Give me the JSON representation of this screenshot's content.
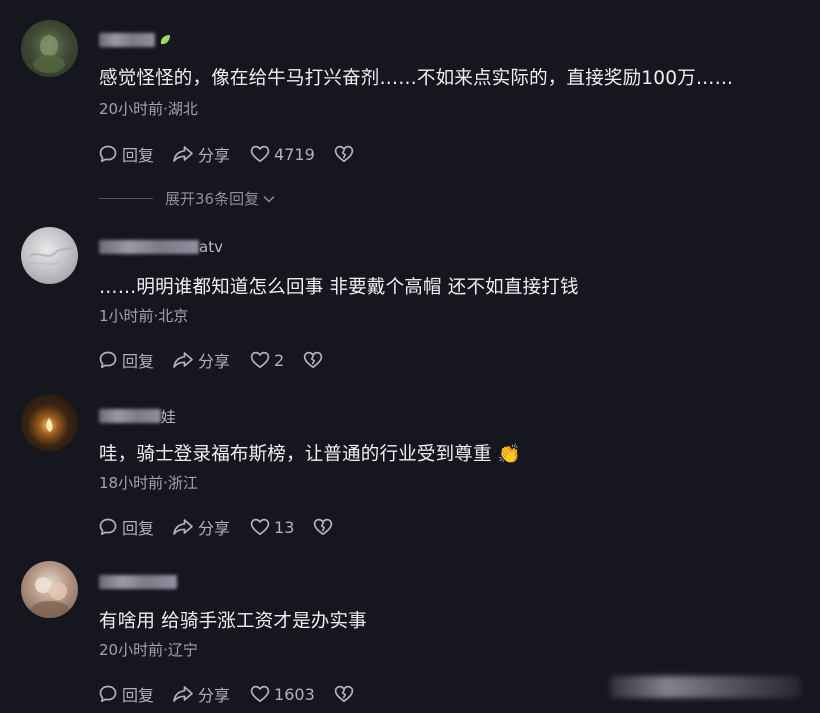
{
  "comments": [
    {
      "username_suffix": "",
      "text": "感觉怪怪的，像在给牛马打兴奋剂……不如来点实际的，直接奖励100万……",
      "meta": "20小时前·湖北",
      "reply_label": "回复",
      "share_label": "分享",
      "likes": "4719"
    },
    {
      "username_suffix": "atv",
      "text": "……明明谁都知道怎么回事 非要戴个高帽 还不如直接打钱",
      "meta": "1小时前·北京",
      "reply_label": "回复",
      "share_label": "分享",
      "likes": "2"
    },
    {
      "username_suffix": "娃",
      "text": "哇，骑士登录福布斯榜，让普通的行业受到尊重 👏",
      "meta": "18小时前·浙江",
      "reply_label": "回复",
      "share_label": "分享",
      "likes": "13"
    },
    {
      "username_suffix": "",
      "text": "有啥用 给骑手涨工资才是办实事",
      "meta": "20小时前·辽宁",
      "reply_label": "回复",
      "share_label": "分享",
      "likes": "1603"
    }
  ],
  "expand_replies": "展开36条回复",
  "colors": {
    "background": "#16161e",
    "text_primary": "#f0f0f4",
    "text_secondary": "#a3a3ad",
    "badge_green": "#9fd86b"
  }
}
